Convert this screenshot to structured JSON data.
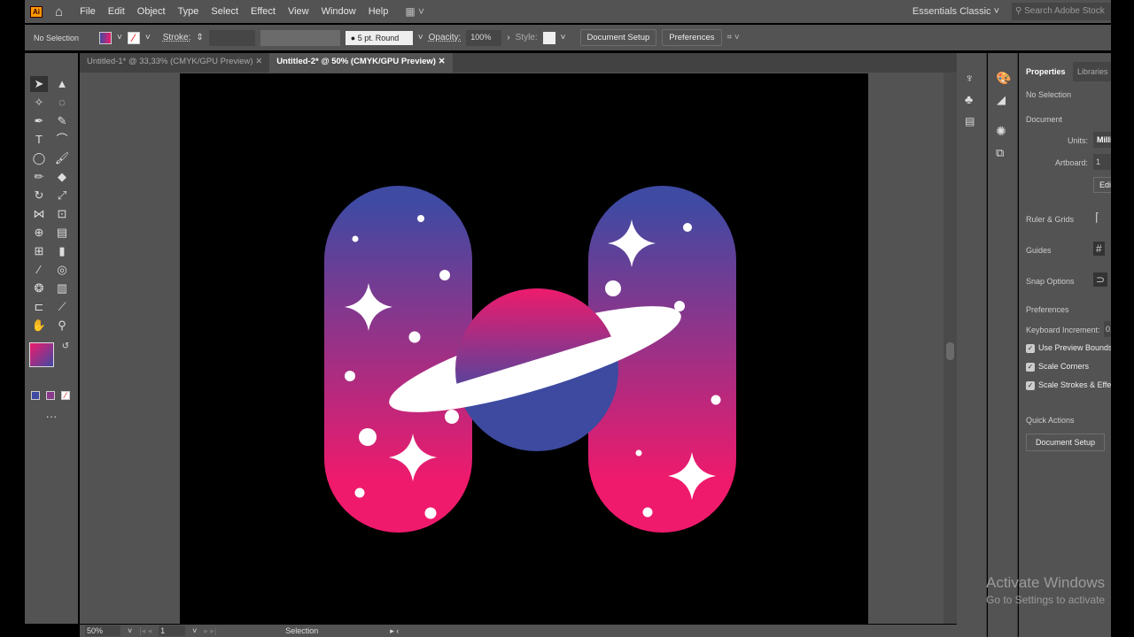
{
  "app": {
    "logo": "Ai"
  },
  "menu": [
    "File",
    "Edit",
    "Object",
    "Type",
    "Select",
    "Effect",
    "View",
    "Window",
    "Help"
  ],
  "workspace": "Essentials Classic",
  "search_placeholder": "Search Adobe Stock",
  "control": {
    "selection": "No Selection",
    "stroke_label": "Stroke:",
    "brush": "5 pt. Round",
    "opacity_label": "Opacity:",
    "opacity": "100%",
    "style_label": "Style:",
    "document_setup": "Document Setup",
    "preferences": "Preferences"
  },
  "tabs": [
    {
      "label": "Untitled-1* @ 33,33% (CMYK/GPU Preview)"
    },
    {
      "label": "Untitled-2* @ 50% (CMYK/GPU Preview)"
    }
  ],
  "status": {
    "zoom": "50%",
    "artboard": "1",
    "tool": "Selection"
  },
  "properties": {
    "tab1": "Properties",
    "tab2": "Libraries",
    "selection": "No Selection",
    "document": "Document",
    "units_label": "Units:",
    "units": "Milli",
    "artboard_label": "Artboard:",
    "artboard": "1",
    "edit": "Edi",
    "ruler": "Ruler & Grids",
    "guides": "Guides",
    "snap": "Snap Options",
    "preferences": "Preferences",
    "keyboard": "Keyboard Increment:",
    "keyboard_value": "0,",
    "use_preview": "Use Preview Bounds",
    "scale_corners": "Scale Corners",
    "scale_strokes": "Scale Strokes & Effe",
    "quick_actions": "Quick Actions",
    "doc_setup": "Document Setup"
  },
  "watermark": {
    "title": "Activate Windows",
    "subtitle": "Go to Settings to activate"
  },
  "colors": {
    "gradient_top": "#3f4aa3",
    "gradient_bottom": "#ef1a6c",
    "ui": "#535353"
  }
}
